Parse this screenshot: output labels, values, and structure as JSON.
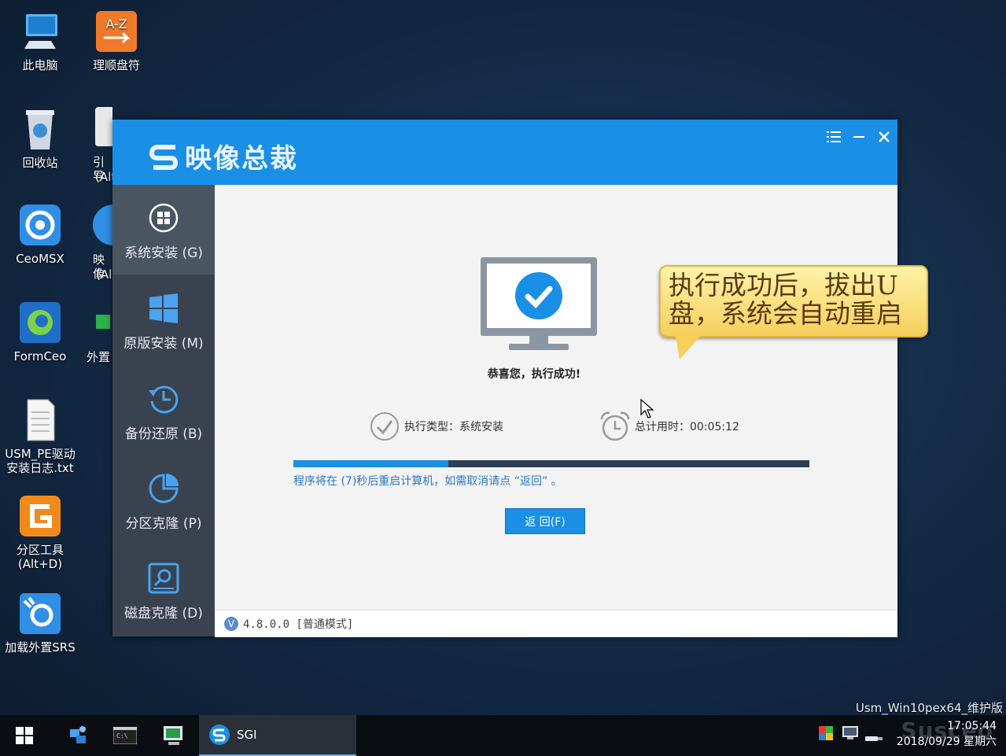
{
  "desktop": {
    "icons": [
      {
        "label": "此电脑"
      },
      {
        "label": "理顺盘符"
      },
      {
        "label": "回收站"
      },
      {
        "label": "CeoMSX"
      },
      {
        "label": "FormCeo"
      },
      {
        "label": "USM_PE驱动安装日志.txt"
      },
      {
        "label": "分区工具(Alt+D)"
      },
      {
        "label": "加载外置SRS"
      }
    ],
    "partial_labels": [
      "引导",
      "(Alt",
      "映像",
      "(Al",
      "外置"
    ]
  },
  "window": {
    "app_title": "映像总裁",
    "controls": {
      "menu_icon": "list-icon",
      "minimize_icon": "minimize-icon",
      "close_icon": "close-icon"
    },
    "sidebar": [
      {
        "label": "系统安装 (G)",
        "icon": "windows-logo-icon",
        "active": true
      },
      {
        "label": "原版安装 (M)",
        "icon": "windows-tiles-icon",
        "active": false
      },
      {
        "label": "备份还原 (B)",
        "icon": "history-clock-icon",
        "active": false
      },
      {
        "label": "分区克隆 (P)",
        "icon": "pie-chart-icon",
        "active": false
      },
      {
        "label": "磁盘克隆 (D)",
        "icon": "disk-search-icon",
        "active": false
      }
    ],
    "result": {
      "congrats": "恭喜您，执行成功!",
      "exec_type": "执行类型：系统安装",
      "elapsed": "总计用时：00:05:12",
      "progress": 0.3,
      "hint": "程序将在 (7)秒后重启计算机，如需取消请点 “返回” 。",
      "back_button": "返 回(F)"
    },
    "status": {
      "version_badge": "V",
      "version": "4.8.0.0 [普通模式]"
    }
  },
  "callout": {
    "text": "执行成功后，拔出U盘，系统会自动重启"
  },
  "taskbar": {
    "active_app": "SGI",
    "clock_time": "17:05:44",
    "clock_date": "2018/09/29 星期六"
  },
  "corner_label": "Usm_Win10pex64_维护版",
  "watermark": "Susceo",
  "colors": {
    "accent": "#1a8fe6",
    "sidebar": "#39424f",
    "callout_bg": "#f6cf5c"
  }
}
